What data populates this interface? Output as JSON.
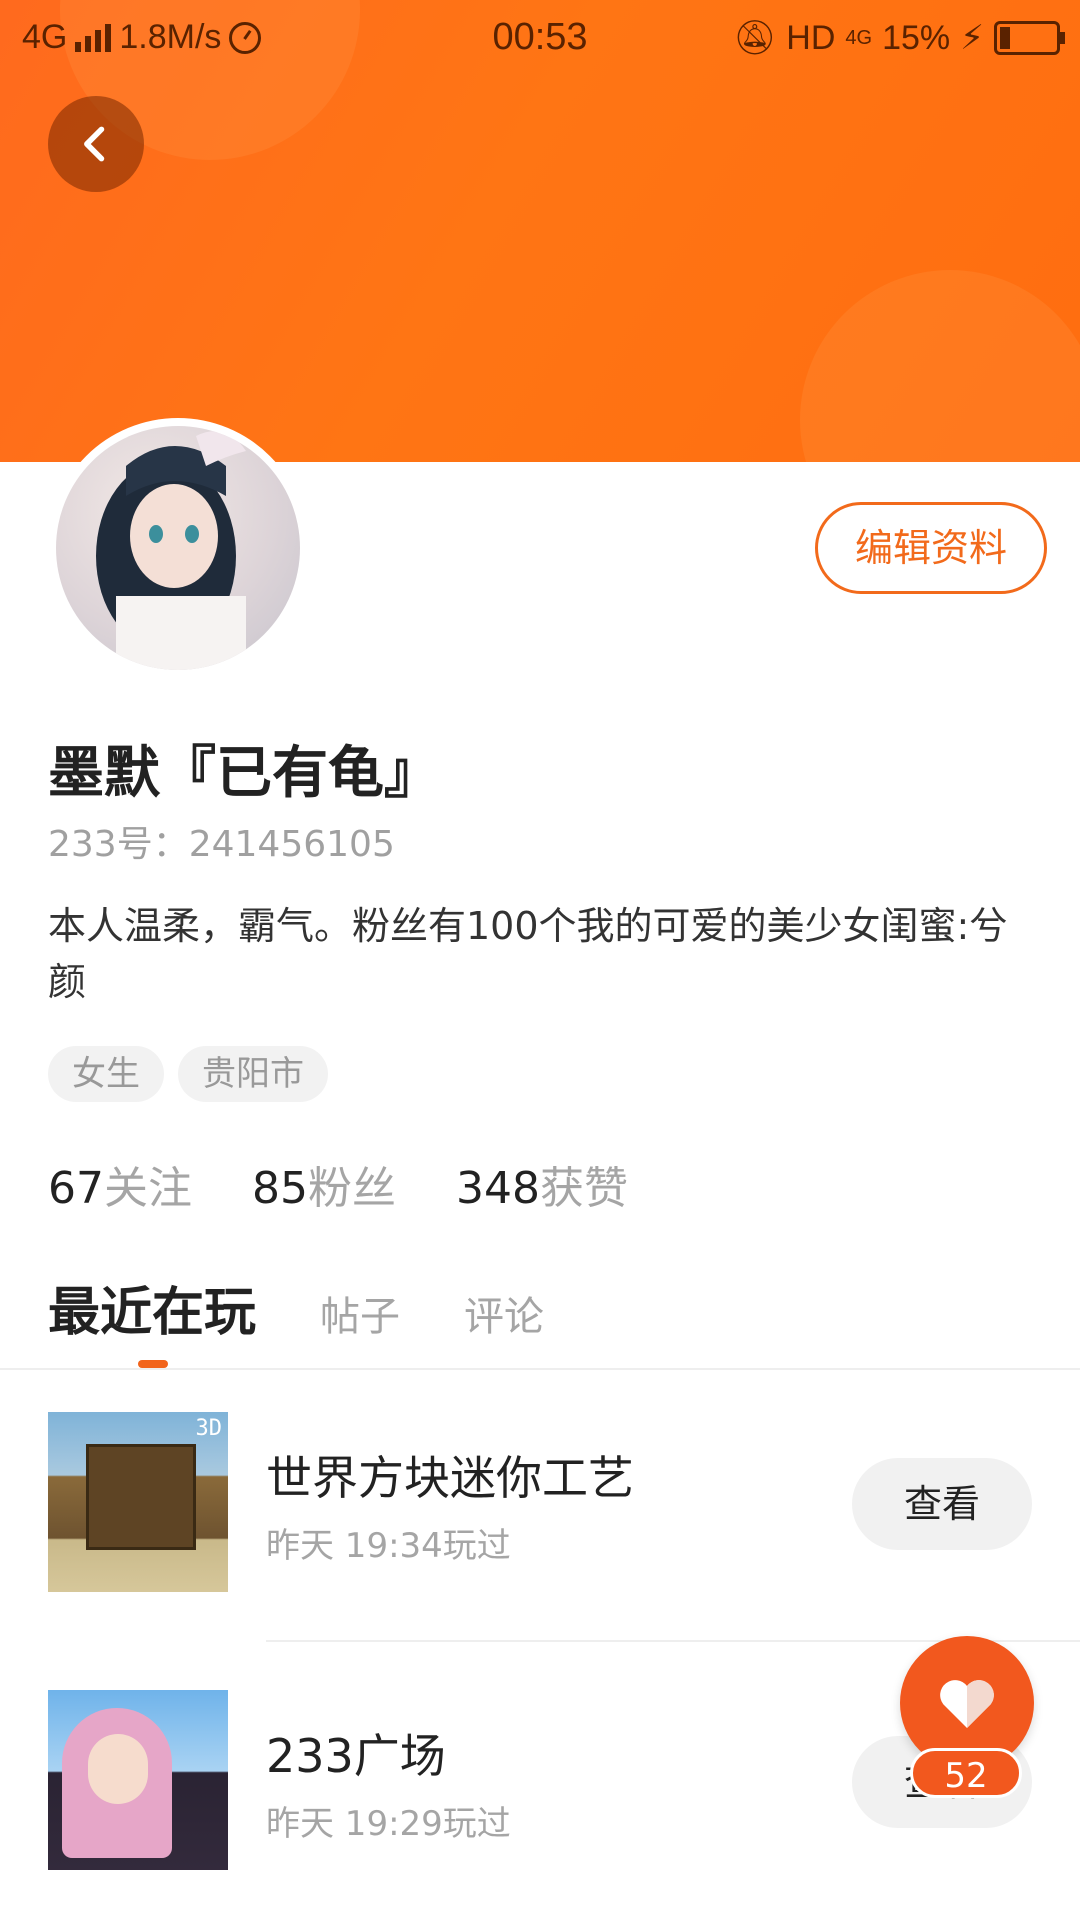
{
  "status_bar": {
    "network": "4G",
    "speed": "1.8M/s",
    "time": "00:53",
    "hd_label": "HD",
    "net2": "4G",
    "battery": "15%"
  },
  "profile": {
    "edit_label": "编辑资料",
    "username": "墨默『已有龟』",
    "uid": "233号：241456105",
    "bio": "本人温柔，霸气。粉丝有100个我的可爱的美少女闺蜜:兮颜",
    "tags": [
      "女生",
      "贵阳市"
    ],
    "stats": [
      {
        "num": "67",
        "label": "关注"
      },
      {
        "num": "85",
        "label": "粉丝"
      },
      {
        "num": "348",
        "label": "获赞"
      }
    ]
  },
  "tabs": [
    "最近在玩",
    "帖子",
    "评论"
  ],
  "games": [
    {
      "title": "世界方块迷你工艺",
      "time": "昨天 19:34玩过",
      "button": "查看",
      "badge": "3D"
    },
    {
      "title": "233广场",
      "time": "昨天 19:29玩过",
      "button": "查看"
    }
  ],
  "fab": {
    "count": "52"
  },
  "colors": {
    "accent": "#f2641b",
    "banner": "#ff6e14"
  }
}
